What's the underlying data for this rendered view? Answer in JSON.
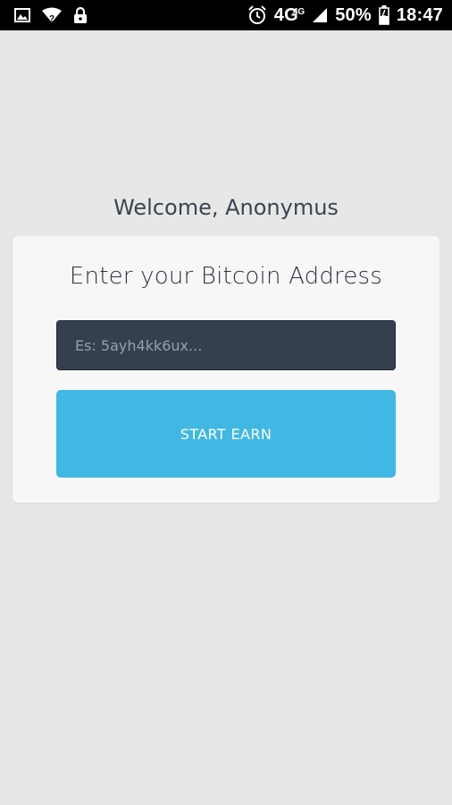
{
  "status_bar": {
    "network": "4G",
    "network_small": "4G",
    "battery": "50%",
    "time": "18:47",
    "icons": {
      "left": [
        "image-icon",
        "wifi-unknown-icon",
        "lock-icon"
      ],
      "right": [
        "alarm-icon",
        "signal-icon",
        "battery-icon"
      ]
    }
  },
  "main": {
    "welcome": "Welcome, Anonymus"
  },
  "card": {
    "title": "Enter your Bitcoin Address",
    "input_placeholder": "Es: 5ayh4kk6ux...",
    "input_value": "",
    "button_label": "START EARN"
  },
  "colors": {
    "background": "#e7e7e7",
    "card": "#f7f7f7",
    "input": "#34404e",
    "button": "#41b8e4",
    "heading": "#3a4553"
  }
}
